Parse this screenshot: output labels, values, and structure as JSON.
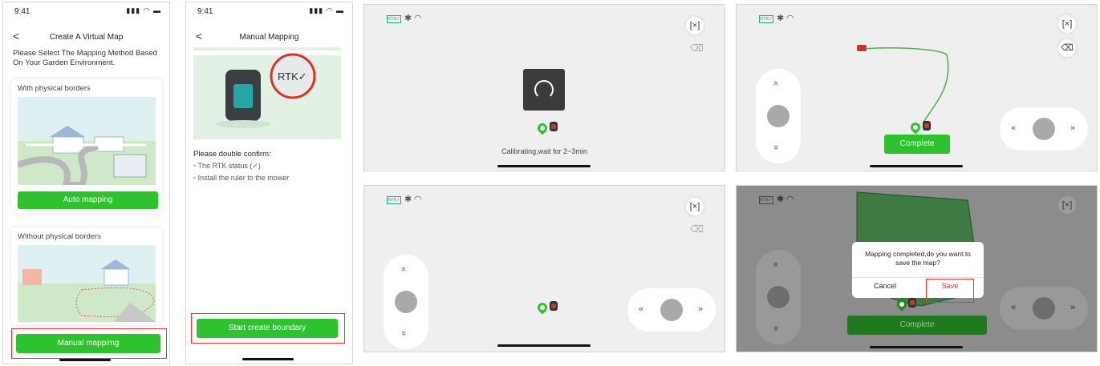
{
  "screen1": {
    "time": "9:41",
    "status_icons": "▮▮▮ ◠ ▬",
    "back": "<",
    "title": "Create A Virtual Map",
    "intro": "Please Select The Mapping Method Based On Your Garden Environment.",
    "card1_label": "With physical borders",
    "card1_button": "Auto mapping",
    "card2_label": "Without physical borders",
    "manual_button": "Manual mappimg"
  },
  "screen2": {
    "time": "9:41",
    "status_icons": "▮▮▮ ◠ ▬",
    "back": "<",
    "title": "Manual Mapping",
    "rtk_badge": "RTK✓",
    "confirm_heading": "Please double confirm:",
    "bullet1": "The RTK status (✓)",
    "bullet2": "Install the ruler to the mower",
    "start_button": "Start create boundary"
  },
  "landscape": {
    "rtk_label": "RTK✓",
    "bluetooth": "✱",
    "wifi": "◠",
    "fit_icon": "[×]",
    "eraser_icon": "⌫",
    "up_arrow": "»",
    "left_arrow": "«",
    "right_arrow": "»",
    "calibrating": "Calibrating,wait for 2~3min",
    "complete": "Complete",
    "dialog_message": "Mapping completed,do you want to save the map?",
    "dialog_cancel": "Cancel",
    "dialog_save": "Save"
  },
  "colors": {
    "primary_green": "#2ec22e",
    "highlight_red": "#e33333",
    "boundary_green": "#4caf50"
  }
}
